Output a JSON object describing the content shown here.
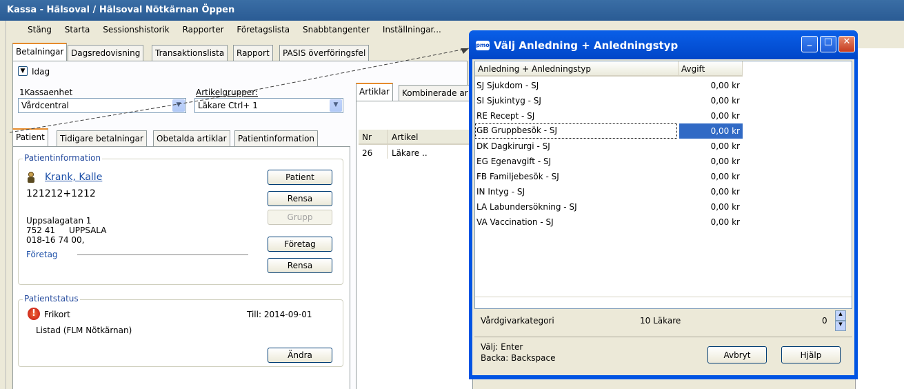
{
  "window_title": "Kassa - Hälsoval / Hälsoval Nötkärnan Öppen",
  "menu": [
    "Stäng",
    "Starta",
    "Sessionshistorik",
    "Rapporter",
    "Företagslista",
    "Snabbtangenter",
    "Inställningar..."
  ],
  "main_tabs": [
    "Betalningar",
    "Dagsredovisning",
    "Transaktionslista",
    "Rapport",
    "PASIS överföringsfel"
  ],
  "idag_label": "Idag",
  "kassaenhet": {
    "label": "1Kassaenhet",
    "value": "Vårdcentral"
  },
  "artikelgrupper": {
    "label": "Artikelgrupper:",
    "value": "Läkare Ctrl+ 1"
  },
  "patient_tabs": [
    "Patient",
    "Tidigare betalningar",
    "Obetalda artiklar",
    "Patientinformation"
  ],
  "patientinfo": {
    "legend": "Patientinformation",
    "name": "Krank, Kalle",
    "pnr": "121212+1212",
    "address1": "Uppsalagatan 1",
    "zip": "752 41",
    "city": "UPPSALA",
    "phone": "018-16 74 00,",
    "company_label": "Företag",
    "buttons": {
      "patient": "Patient",
      "rensa1": "Rensa",
      "grupp": "Grupp",
      "foretag": "Företag",
      "rensa2": "Rensa"
    }
  },
  "patientstatus": {
    "legend": "Patientstatus",
    "frikort": "Frikort",
    "till": "Till: 2014-09-01",
    "listad": "Listad (FLM Nötkärnan)",
    "andra": "Ändra"
  },
  "article_tabs": [
    "Artiklar",
    "Kombinerade ar"
  ],
  "article_table": {
    "headers": [
      "Nr",
      "Artikel"
    ],
    "rows": [
      [
        "26",
        "Läkare .."
      ]
    ]
  },
  "dialog": {
    "logo": "pmo",
    "title": "Välj Anledning + Anledningstyp",
    "headers": [
      "Anledning + Anledningstyp",
      "Avgift"
    ],
    "rows": [
      [
        "SJ Sjukdom - SJ",
        "0,00 kr"
      ],
      [
        "SI Sjukintyg - SJ",
        "0,00 kr"
      ],
      [
        "RE Recept - SJ",
        "0,00 kr"
      ],
      [
        "GB Gruppbesök - SJ",
        "0,00 kr"
      ],
      [
        "DK Dagkirurgi - SJ",
        "0,00 kr"
      ],
      [
        "EG Egenavgift - SJ",
        "0,00 kr"
      ],
      [
        "FB Familjebesök - SJ",
        "0,00 kr"
      ],
      [
        "IN Intyg - SJ",
        "0,00 kr"
      ],
      [
        "LA Labundersökning - SJ",
        "0,00 kr"
      ],
      [
        "VA Vaccination - SJ",
        "0,00 kr"
      ]
    ],
    "selected_index": 3,
    "vardgivarkategori_label": "Vårdgivarkategori",
    "vardgivarkategori_value": "10 Läkare",
    "spinner_value": "0",
    "hint1": "Välj: Enter",
    "hint2": "Backa: Backspace",
    "avbryt": "Avbryt",
    "hjalp": "Hjälp"
  }
}
